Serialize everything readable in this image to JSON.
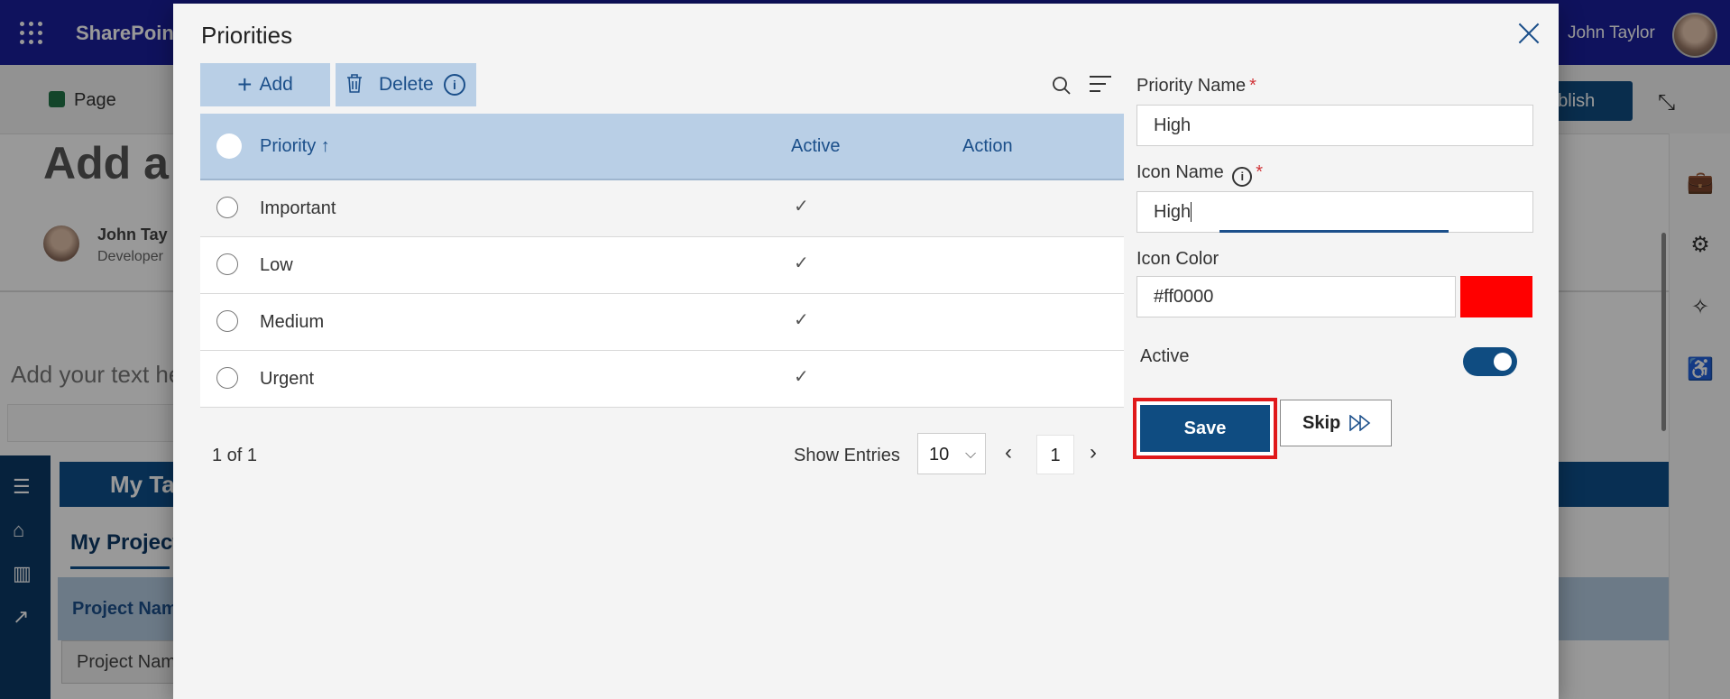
{
  "background": {
    "app_name": "SharePoin",
    "user_name": "John Taylor",
    "command_bar": {
      "page_label": "Page",
      "publish_label": "ublish"
    },
    "page_title": "Add a",
    "author": {
      "name": "John Tay",
      "role": "Developer"
    },
    "add_text_placeholder": "Add your text he",
    "webpart_title": "My Ta",
    "section_title": "My Project",
    "table_header": "Project Nam",
    "table_cell": "Project Nam"
  },
  "dialog": {
    "title": "Priorities",
    "toolbar": {
      "add_label": "Add",
      "delete_label": "Delete"
    },
    "table": {
      "columns": [
        "Priority",
        "Active",
        "Action"
      ],
      "sort_indicator": "↑",
      "rows": [
        {
          "name": "Important",
          "active": "✓"
        },
        {
          "name": "Low",
          "active": "✓"
        },
        {
          "name": "Medium",
          "active": "✓"
        },
        {
          "name": "Urgent",
          "active": "✓"
        }
      ]
    },
    "pagination": {
      "count": "1 of 1",
      "show_entries_label": "Show Entries",
      "entries_value": "10",
      "current_page": "1"
    },
    "form": {
      "priority_name_label": "Priority Name",
      "priority_name_value": "High",
      "icon_name_label": "Icon Name",
      "icon_name_value": "High",
      "icon_color_label": "Icon Color",
      "icon_color_value": "#ff0000",
      "active_label": "Active",
      "active_value": true,
      "required_marker": "*",
      "save_label": "Save",
      "skip_label": "Skip"
    }
  },
  "colors": {
    "brand_bar": "#1a1f9c",
    "accent": "#0f4c81",
    "table_header": "#b9cfe6",
    "highlight_border": "#e0191b",
    "swatch": "#ff0000"
  }
}
